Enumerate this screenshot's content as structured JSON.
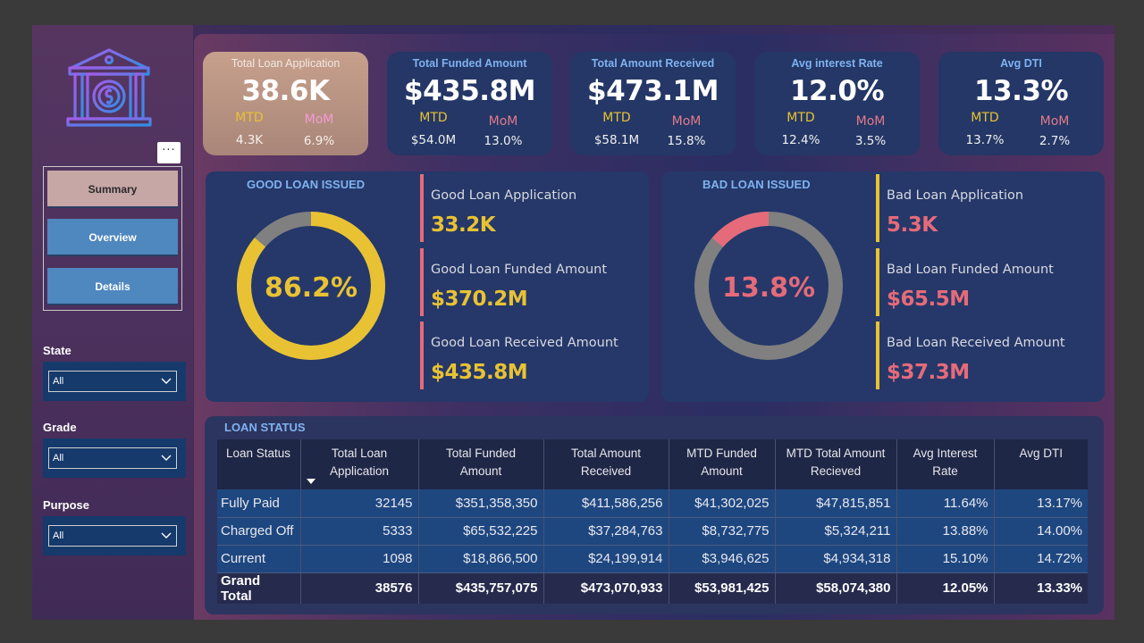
{
  "colors": {
    "good": "#e8c233",
    "bad": "#e56b7a",
    "ring_rest": "#808080",
    "accent_blue": "#7fb2ef"
  },
  "sidebar": {
    "logo_icon": "bank-dollar-icon",
    "more_label": "···",
    "nav": [
      {
        "label": "Summary",
        "active": true
      },
      {
        "label": "Overview",
        "active": false
      },
      {
        "label": "Details",
        "active": false
      }
    ],
    "filters": [
      {
        "label": "State",
        "value": "All"
      },
      {
        "label": "Grade",
        "value": "All"
      },
      {
        "label": "Purpose",
        "value": "All"
      }
    ]
  },
  "kpis": [
    {
      "title": "Total Loan Application",
      "value": "38.6K",
      "mtd_label": "MTD",
      "mom_label": "MoM",
      "mtd": "4.3K",
      "mom": "6.9%"
    },
    {
      "title": "Total Funded Amount",
      "value": "$435.8M",
      "mtd_label": "MTD",
      "mom_label": "MoM",
      "mtd": "$54.0M",
      "mom": "13.0%"
    },
    {
      "title": "Total  Amount Received",
      "value": "$473.1M",
      "mtd_label": "MTD",
      "mom_label": "MoM",
      "mtd": "$58.1M",
      "mom": "15.8%"
    },
    {
      "title": "Avg interest Rate",
      "value": "12.0%",
      "mtd_label": "MTD",
      "mom_label": "MoM",
      "mtd": "12.4%",
      "mom": "3.5%"
    },
    {
      "title": "Avg DTI",
      "value": "13.3%",
      "mtd_label": "MTD",
      "mom_label": "MoM",
      "mtd": "13.7%",
      "mom": "2.7%"
    }
  ],
  "good_loans": {
    "title": "GOOD LOAN ISSUED",
    "percent_label": "86.2%",
    "percent": 0.862,
    "metrics": [
      {
        "label": "Good Loan Application",
        "value": "33.2K"
      },
      {
        "label": "Good Loan Funded Amount",
        "value": "$370.2M"
      },
      {
        "label": "Good Loan Received Amount",
        "value": "$435.8M"
      }
    ]
  },
  "bad_loans": {
    "title": "BAD LOAN ISSUED",
    "percent_label": "13.8%",
    "percent": 0.138,
    "metrics": [
      {
        "label": "Bad Loan Application",
        "value": "5.3K"
      },
      {
        "label": "Bad Loan Funded Amount",
        "value": "$65.5M"
      },
      {
        "label": "Bad Loan Received Amount",
        "value": "$37.3M"
      }
    ]
  },
  "loan_status": {
    "title": "LOAN STATUS",
    "headers": [
      "Loan Status",
      "Total Loan Application",
      "Total Funded Amount",
      "Total Amount Received",
      "MTD Funded Amount",
      "MTD Total Amount Recieved",
      "Avg Interest Rate",
      "Avg DTI"
    ],
    "rows": [
      [
        "Fully Paid",
        "32145",
        "$351,358,350",
        "$411,586,256",
        "$41,302,025",
        "$47,815,851",
        "11.64%",
        "13.17%"
      ],
      [
        "Charged Off",
        "5333",
        "$65,532,225",
        "$37,284,763",
        "$8,732,775",
        "$5,324,211",
        "13.88%",
        "14.00%"
      ],
      [
        "Current",
        "1098",
        "$18,866,500",
        "$24,199,914",
        "$3,946,625",
        "$4,934,318",
        "15.10%",
        "14.72%"
      ]
    ],
    "total": [
      "Grand Total",
      "38576",
      "$435,757,075",
      "$473,070,933",
      "$53,981,425",
      "$58,074,380",
      "12.05%",
      "13.33%"
    ]
  }
}
